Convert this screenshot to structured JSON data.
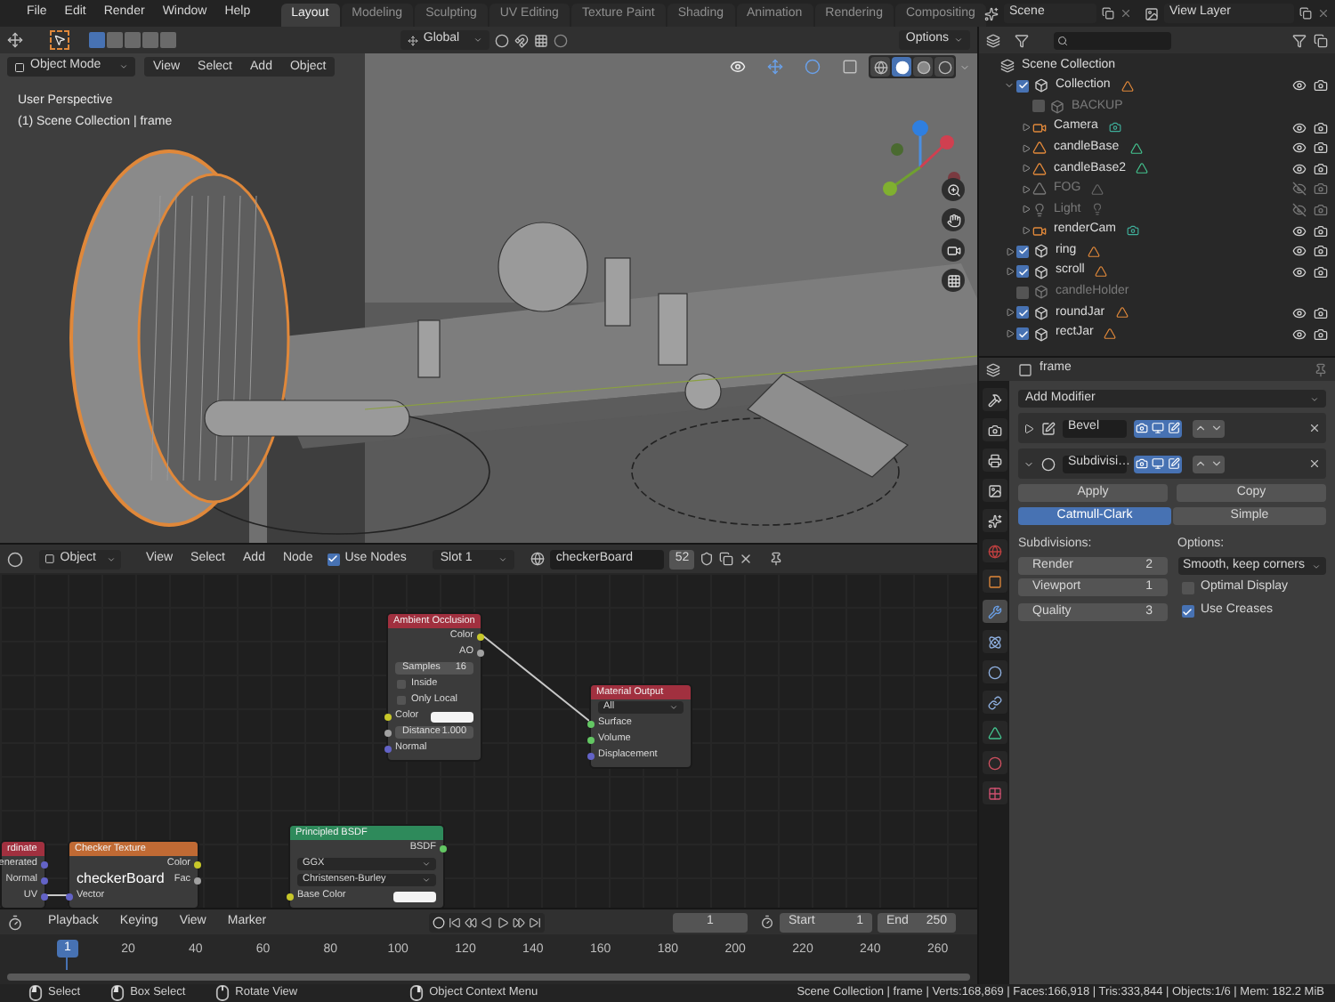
{
  "top_bar": {
    "menus": [
      "File",
      "Edit",
      "Render",
      "Window",
      "Help"
    ],
    "workspaces": [
      {
        "label": "Layout",
        "selected": true
      },
      {
        "label": "Modeling",
        "selected": false
      },
      {
        "label": "Sculpting",
        "selected": false
      },
      {
        "label": "UV Editing",
        "selected": false
      },
      {
        "label": "Texture Paint",
        "selected": false
      },
      {
        "label": "Shading",
        "selected": false
      },
      {
        "label": "Animation",
        "selected": false
      },
      {
        "label": "Rendering",
        "selected": false
      },
      {
        "label": "Compositing",
        "selected": false
      }
    ],
    "scene": "Scene",
    "view_layer": "View Layer"
  },
  "tool_header": {
    "orientation": "Global",
    "options": "Options"
  },
  "viewport": {
    "mode": "Object Mode",
    "menus": [
      "View",
      "Select",
      "Add",
      "Object"
    ],
    "info": [
      "User Perspective",
      "(1) Scene Collection | frame"
    ],
    "shading": [
      {
        "kind": "wireframe",
        "selected": false
      },
      {
        "kind": "solid",
        "selected": true
      },
      {
        "kind": "material",
        "selected": false
      },
      {
        "kind": "rendered",
        "selected": false
      }
    ]
  },
  "node_editor": {
    "object_type": "Object",
    "menus": [
      "View",
      "Select",
      "Add",
      "Node"
    ],
    "use_nodes": {
      "label": "Use Nodes",
      "checked": true
    },
    "slot": "Slot 1",
    "material": "checkerBoard",
    "users": "52",
    "overlay_label": "checkerBoard",
    "nodes": [
      {
        "title": "Ambient Occlusion",
        "color": "#a1303f",
        "rows": [
          {
            "kind": "output",
            "label": "Color",
            "color": "#c7c729"
          },
          {
            "kind": "output",
            "label": "AO",
            "color": "#a1a1a1"
          },
          {
            "kind": "field",
            "label": "Samples",
            "value": "16"
          },
          {
            "kind": "check",
            "label": "Inside",
            "checked": false
          },
          {
            "kind": "check",
            "label": "Only Local",
            "checked": false
          },
          {
            "kind": "color",
            "label": "Color",
            "color": "#c7c729"
          },
          {
            "kind": "field",
            "label": "Distance",
            "value": "1.000",
            "color": "#a1a1a1"
          },
          {
            "kind": "input",
            "label": "Normal",
            "color": "#6363c7"
          }
        ]
      },
      {
        "title": "Material Output",
        "color": "#a1303f",
        "rows": [
          {
            "kind": "dropdown",
            "label": "All"
          },
          {
            "kind": "input",
            "label": "Surface",
            "color": "#63c763"
          },
          {
            "kind": "input",
            "label": "Volume",
            "color": "#63c763"
          },
          {
            "kind": "input",
            "label": "Displacement",
            "color": "#6363c7"
          }
        ]
      },
      {
        "title": "rdinate",
        "color": "#a1303f",
        "rows": [
          {
            "kind": "output",
            "label": "enerated",
            "color": "#6363c7"
          },
          {
            "kind": "output",
            "label": "Normal",
            "color": "#6363c7"
          },
          {
            "kind": "output",
            "label": "UV",
            "color": "#6363c7"
          }
        ]
      },
      {
        "title": "Checker Texture",
        "color": "#c06a34",
        "rows": [
          {
            "kind": "output",
            "label": "Color",
            "color": "#c7c729"
          },
          {
            "kind": "output",
            "label": "Fac",
            "color": "#a1a1a1"
          },
          {
            "kind": "input",
            "label": "Vector",
            "color": "#6363c7"
          }
        ]
      },
      {
        "title": "Principled BSDF",
        "color": "#2e8a5b",
        "rows": [
          {
            "kind": "output",
            "label": "BSDF",
            "color": "#63c763"
          },
          {
            "kind": "dropdown",
            "label": "GGX"
          },
          {
            "kind": "dropdown",
            "label": "Christensen-Burley"
          },
          {
            "kind": "color",
            "label": "Base Color",
            "color": "#c7c729"
          }
        ]
      }
    ]
  },
  "timeline": {
    "menus": [
      "Playback",
      "Keying",
      "View",
      "Marker"
    ],
    "current_frame": "1",
    "start_label": "Start",
    "start": "1",
    "end_label": "End",
    "end": "250",
    "playhead": "1",
    "ruler": [
      "20",
      "40",
      "60",
      "80",
      "100",
      "120",
      "140",
      "160",
      "180",
      "200",
      "220",
      "240",
      "260"
    ]
  },
  "outliner": {
    "tree": [
      {
        "name": "Scene Collection",
        "kind": "scene",
        "children": [
          {
            "name": "Collection",
            "kind": "collection",
            "checked": true,
            "hidden": false,
            "expanded": true,
            "children": [
              {
                "name": "BACKUP",
                "kind": "collection",
                "checked": false,
                "hidden": true
              },
              {
                "name": "Camera",
                "kind": "camera",
                "hidden": false,
                "expanded": false
              },
              {
                "name": "candleBase",
                "kind": "mesh",
                "hidden": false,
                "expanded": false
              },
              {
                "name": "candleBase2",
                "kind": "mesh",
                "hidden": false,
                "expanded": false
              },
              {
                "name": "FOG",
                "kind": "mesh",
                "hidden": true,
                "expanded": false
              },
              {
                "name": "Light",
                "kind": "light",
                "hidden": true,
                "expanded": false
              },
              {
                "name": "renderCam",
                "kind": "camera",
                "hidden": false,
                "expanded": false
              }
            ]
          },
          {
            "name": "ring",
            "kind": "collection",
            "checked": true,
            "hidden": false,
            "expanded": false
          },
          {
            "name": "scroll",
            "kind": "collection",
            "checked": true,
            "hidden": false,
            "expanded": false
          },
          {
            "name": "candleHolder",
            "kind": "collection",
            "checked": false,
            "hidden": true
          },
          {
            "name": "roundJar",
            "kind": "collection",
            "checked": true,
            "hidden": false,
            "expanded": false
          },
          {
            "name": "rectJar",
            "kind": "collection",
            "checked": true,
            "hidden": false,
            "expanded": false
          }
        ]
      }
    ]
  },
  "properties": {
    "object": "frame",
    "add_modifier": "Add Modifier",
    "tabs": [
      {
        "kind": "tool",
        "selected": false
      },
      {
        "kind": "render",
        "selected": false
      },
      {
        "kind": "output",
        "selected": false
      },
      {
        "kind": "view_layer",
        "selected": false
      },
      {
        "kind": "scene",
        "selected": false
      },
      {
        "kind": "world",
        "selected": false
      },
      {
        "kind": "object",
        "selected": false
      },
      {
        "kind": "modifier",
        "selected": true
      },
      {
        "kind": "particles",
        "selected": false
      },
      {
        "kind": "physics",
        "selected": false
      },
      {
        "kind": "constraints",
        "selected": false
      },
      {
        "kind": "data",
        "selected": false
      },
      {
        "kind": "material",
        "selected": false
      },
      {
        "kind": "texture",
        "selected": false
      }
    ],
    "modifiers": [
      {
        "name": "Bevel",
        "kind": "bevel",
        "expanded": false
      },
      {
        "name": "Subdivisi…",
        "kind": "subdivision",
        "expanded": true
      }
    ],
    "actions": [
      "Apply",
      "Copy"
    ],
    "algorithms": [
      {
        "label": "Catmull-Clark",
        "selected": true
      },
      {
        "label": "Simple",
        "selected": false
      }
    ],
    "subdivisions_label": "Subdivisions:",
    "levels": [
      {
        "label": "Render",
        "value": "2"
      },
      {
        "label": "Viewport",
        "value": "1"
      },
      {
        "label": "Quality",
        "value": "3"
      }
    ],
    "options_label": "Options:",
    "uv_smooth": "Smooth, keep corners",
    "options": [
      {
        "label": "Optimal Display",
        "checked": false
      },
      {
        "label": "Use Creases",
        "checked": true
      }
    ]
  },
  "status_bar": {
    "hints": [
      {
        "kind": "left",
        "label": "Select"
      },
      {
        "kind": "drag",
        "label": "Box Select"
      },
      {
        "kind": "middle",
        "label": "Rotate View"
      },
      {
        "kind": "right",
        "label": "Object Context Menu"
      }
    ],
    "stats": "Scene Collection | frame | Verts:168,869 | Faces:166,918 | Tris:333,844 | Objects:1/6 | Mem: 182.2 MiB"
  }
}
